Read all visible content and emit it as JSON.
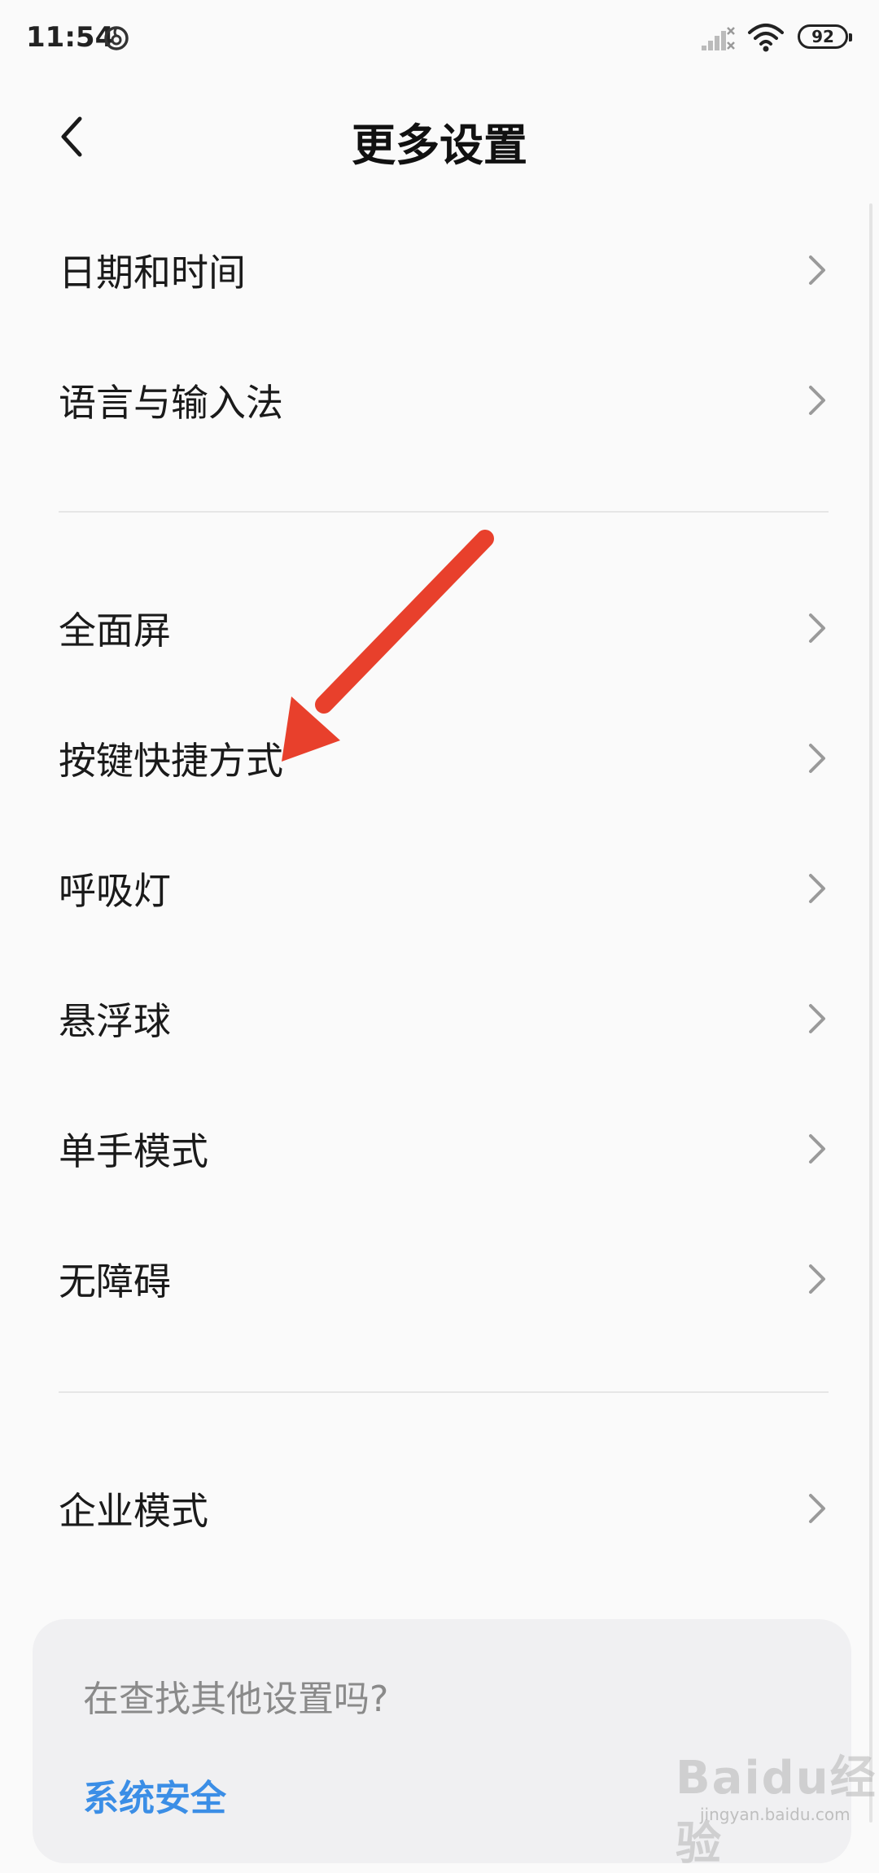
{
  "status_bar": {
    "time": "11:54",
    "battery": "92",
    "icons": [
      "app-notification-icon",
      "signal-off-icon",
      "wifi-icon",
      "battery-icon"
    ]
  },
  "header": {
    "title": "更多设置",
    "back_icon": "chevron-left-icon"
  },
  "sections": [
    {
      "items": [
        {
          "label": "日期和时间"
        },
        {
          "label": "语言与输入法"
        }
      ]
    },
    {
      "items": [
        {
          "label": "全面屏"
        },
        {
          "label": "按键快捷方式"
        },
        {
          "label": "呼吸灯"
        },
        {
          "label": "悬浮球"
        },
        {
          "label": "单手模式"
        },
        {
          "label": "无障碍"
        }
      ]
    },
    {
      "items": [
        {
          "label": "企业模式"
        }
      ]
    }
  ],
  "suggestion_card": {
    "title": "在查找其他设置吗?",
    "link": "系统安全"
  },
  "annotation": {
    "color": "#e8402c",
    "target": "按键快捷方式"
  },
  "watermark": {
    "text": "Baidu经验",
    "sub": "jingyan.baidu.com"
  }
}
